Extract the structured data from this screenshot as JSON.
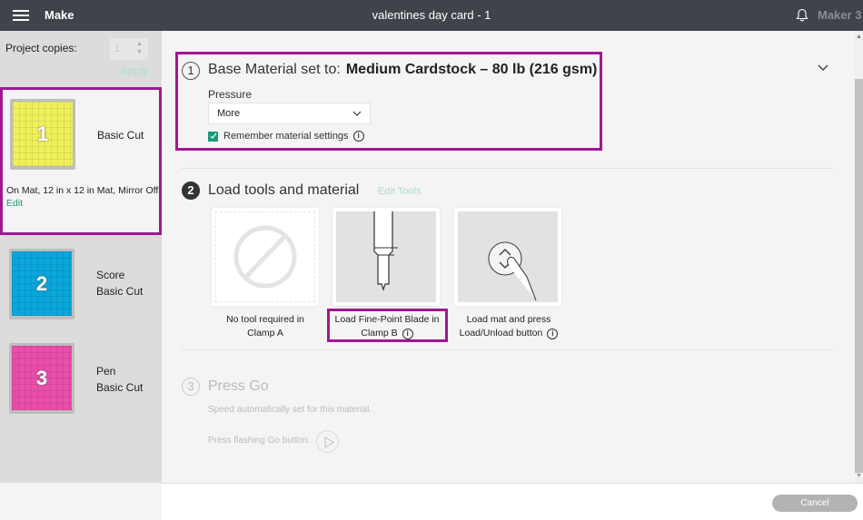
{
  "header": {
    "app_title": "Make",
    "document_title": "valentines day card - 1",
    "machine_name": "Maker 3",
    "icons": [
      "menu-icon",
      "bell-icon"
    ]
  },
  "sidebar": {
    "copies_label": "Project copies:",
    "copies_value": "1",
    "apply_label": "Apply",
    "mats": [
      {
        "number": "1",
        "color": "#eff05a",
        "lines": [
          "Basic Cut"
        ],
        "info": "On Mat, 12 in x 12 in Mat, Mirror Off",
        "edit_label": "Edit",
        "selected": true
      },
      {
        "number": "2",
        "color": "#0aa6da",
        "lines": [
          "Score",
          "Basic Cut"
        ]
      },
      {
        "number": "3",
        "color": "#e84eaa",
        "lines": [
          "Pen",
          "Basic Cut"
        ]
      }
    ]
  },
  "step1": {
    "number": "1",
    "title": "Base Material set to:",
    "material": "Medium Cardstock – 80 lb (216 gsm)",
    "pressure_label": "Pressure",
    "pressure_value": "More",
    "remember_label": "Remember material settings",
    "remember_checked": true
  },
  "step2": {
    "number": "2",
    "title": "Load tools and material",
    "edit_tools_label": "Edit Tools",
    "tools": [
      {
        "caption_line1": "No tool required in",
        "caption_line2": "Clamp A",
        "icon": "no-tool-icon"
      },
      {
        "caption_line1": "Load Fine-Point Blade in",
        "caption_line2": "Clamp B",
        "icon": "fine-point-blade-icon"
      },
      {
        "caption_line1": "Load mat and press",
        "caption_line2": "Load/Unload button",
        "icon": "load-unload-button-icon"
      }
    ]
  },
  "step3": {
    "number": "3",
    "title": "Press Go",
    "speed_text": "Speed automatically set for this material.",
    "go_text": "Press flashing Go button."
  },
  "footer": {
    "cancel_label": "Cancel"
  }
}
